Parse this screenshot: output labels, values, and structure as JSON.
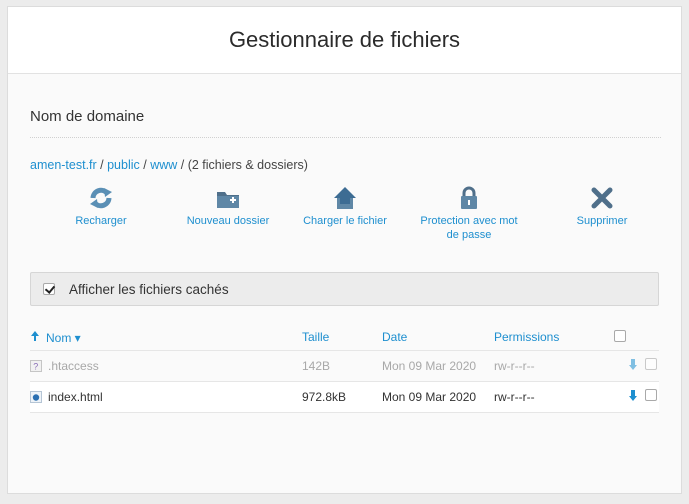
{
  "header": {
    "title": "Gestionnaire de fichiers"
  },
  "section": {
    "title": "Nom de domaine"
  },
  "breadcrumb": {
    "domain": "amen-test.fr",
    "sep1": " / ",
    "folder1": "public",
    "sep2": " / ",
    "folder2": "www",
    "sep3": " / ",
    "count": "(2 fichiers & dossiers)"
  },
  "toolbar": {
    "reload": "Recharger",
    "new_folder": "Nouveau dossier",
    "upload": "Charger le fichier",
    "protect_line1": "Protection avec mot",
    "protect_line2": "de passe",
    "delete": "Supprimer"
  },
  "hidden_files": {
    "label": "Afficher les fichiers cachés",
    "checked": true
  },
  "table": {
    "columns": {
      "name": "Nom ▾",
      "size": "Taille",
      "date": "Date",
      "permissions": "Permissions"
    },
    "rows": [
      {
        "name": ".htaccess",
        "size": "142B",
        "date": "Mon 09 Mar 2020",
        "permissions": "rw-r--r--",
        "icon": "unknown-file-icon",
        "hidden": true
      },
      {
        "name": "index.html",
        "size": "972.8kB",
        "date": "Mon 09 Mar 2020",
        "permissions": "rw-r--r--",
        "icon": "html-file-icon",
        "hidden": false
      }
    ]
  },
  "colors": {
    "accent": "#1e8fcf",
    "bar_bg": "#ececec"
  }
}
